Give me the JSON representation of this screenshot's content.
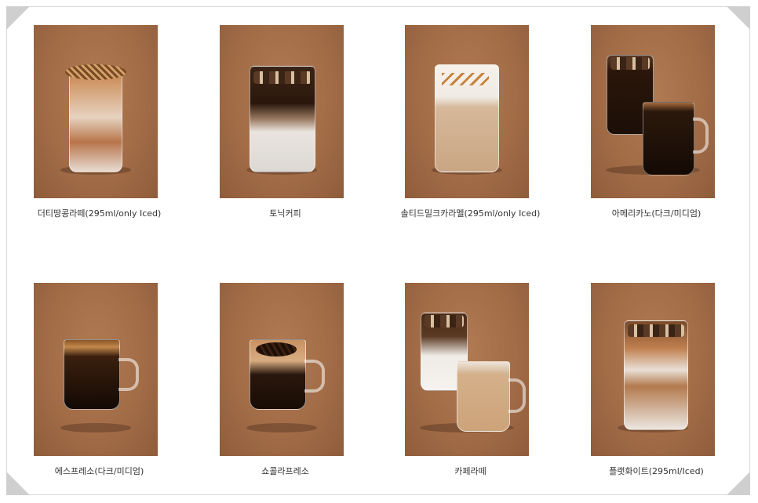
{
  "menu": {
    "items": [
      {
        "name": "더티땅콩라떼(295ml/only Iced)"
      },
      {
        "name": "토닉커피"
      },
      {
        "name": "솔티드밀크카라멜(295ml/only Iced)"
      },
      {
        "name": "아메리카노(다크/미디엄)"
      },
      {
        "name": "에스프레소(다크/미디엄)"
      },
      {
        "name": "쇼콜라프레소"
      },
      {
        "name": "카페라떼"
      },
      {
        "name": "플랫화이트(295ml/Iced)"
      }
    ]
  },
  "colors": {
    "photo_background": "#a26c47",
    "caption_text": "#333333",
    "frame_border": "#d9d9d9"
  }
}
